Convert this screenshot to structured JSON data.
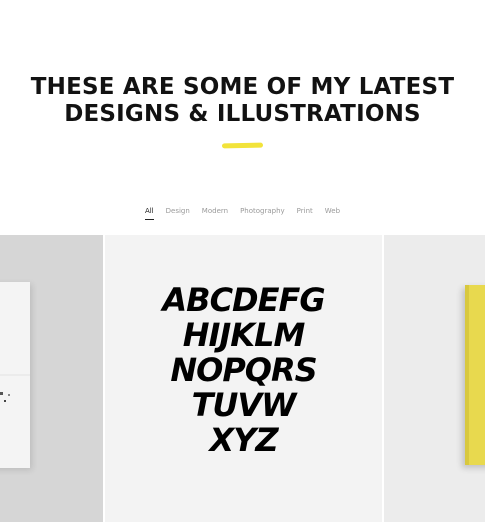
{
  "header": {
    "line1": "THESE ARE SOME OF MY LATEST",
    "line2": "DESIGNS & ILLUSTRATIONS",
    "accent_color": "#f2e33a"
  },
  "filters": {
    "items": [
      "All",
      "Design",
      "Modern",
      "Photography",
      "Print",
      "Web"
    ],
    "active": "All"
  },
  "gallery": {
    "lettering_rows": [
      "ABCDEFG",
      "HIJKLM",
      "NOPQRS",
      "TUVW",
      "XYZ"
    ]
  }
}
